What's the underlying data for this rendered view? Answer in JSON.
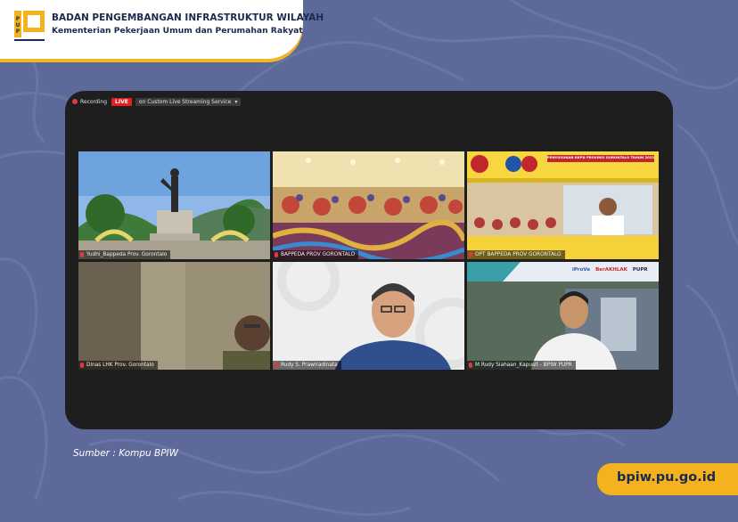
{
  "header": {
    "org_title": "BADAN PENGEMBANGAN INFRASTRUKTUR WILAYAH",
    "org_subtitle": "Kementerian Pekerjaan Umum dan Perumahan Rakyat",
    "logo_icon": "pupr-logo-icon"
  },
  "meeting": {
    "recording_label": "Recording",
    "live_label": "LIVE",
    "stream_label": "on Custom Live Streaming Service",
    "participants": [
      {
        "name": "Yudhi_Bappeda Prov. Gorontalo",
        "scene": "monument"
      },
      {
        "name": "BAPPEDA PROV GORONTALO",
        "scene": "ballroom"
      },
      {
        "name": "OPT BAPPEDA PROV GORONTALO",
        "scene": "presentation"
      },
      {
        "name": "Dinas LHK Prov. Gorontalo",
        "scene": "officer"
      },
      {
        "name": "Rudy S. Prawiradinata",
        "scene": "speaker"
      },
      {
        "name": "M Rudy Siahaan_Kapuslt - BPIW PUPR",
        "scene": "banner-room"
      }
    ],
    "presentation_title": "PENYUSUNAN RKPD PROVINSI GORONTALO TAHUN 2023",
    "banner_logos": [
      "iProVe",
      "BerAKHLAK",
      "PUPR"
    ]
  },
  "footer": {
    "source": "Sumber : Kompu BPIW",
    "url": "bpiw.pu.go.id"
  },
  "colors": {
    "background": "#5d6a99",
    "accent_yellow": "#f5b21f",
    "navy": "#1c2a4e",
    "live_red": "#e02020",
    "active_speaker": "#c6e34a"
  }
}
